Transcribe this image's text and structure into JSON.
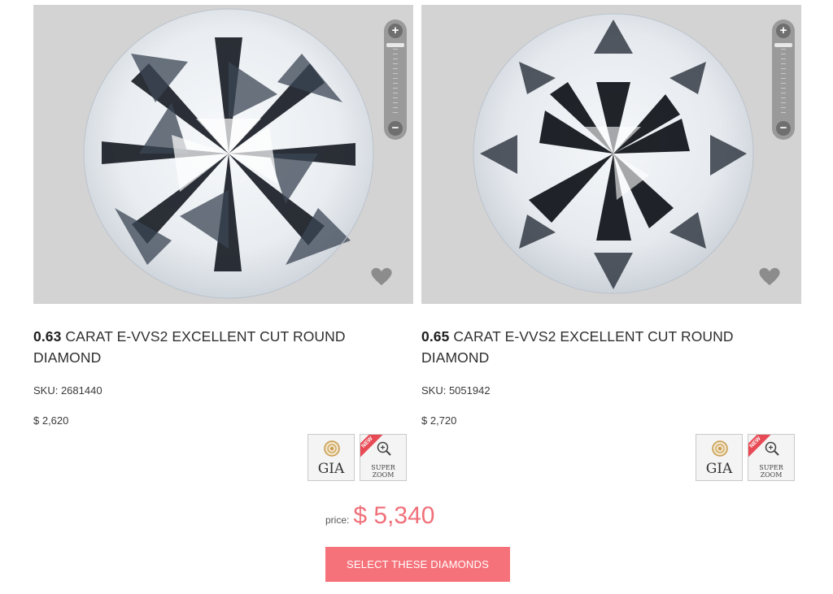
{
  "products": [
    {
      "carat": "0.63",
      "title_rest": " CARAT E-VVS2 EXCELLENT CUT ROUND DIAMOND",
      "sku": "SKU: 2681440",
      "price": "$ 2,620",
      "zoom_plus": "+",
      "zoom_minus": "−",
      "badge_gia": "GIA",
      "badge_new": "NEW",
      "badge_super_zoom": "SUPER\nZOOM"
    },
    {
      "carat": "0.65",
      "title_rest": " CARAT E-VVS2 EXCELLENT CUT ROUND DIAMOND",
      "sku": "SKU: 5051942",
      "price": "$ 2,720",
      "zoom_plus": "+",
      "zoom_minus": "−",
      "badge_gia": "GIA",
      "badge_new": "NEW",
      "badge_super_zoom": "SUPER\nZOOM"
    }
  ],
  "total": {
    "label": "price:",
    "value": "$ 5,340"
  },
  "select_button": "SELECT THESE DIAMONDS",
  "colors": {
    "accent": "#f6727a",
    "price_text": "#f0707a",
    "photo_bg": "#d3d3d3"
  },
  "icons": [
    "zoom-in-icon",
    "zoom-out-icon",
    "heart-icon",
    "gia-seal-icon",
    "magnifier-icon"
  ]
}
